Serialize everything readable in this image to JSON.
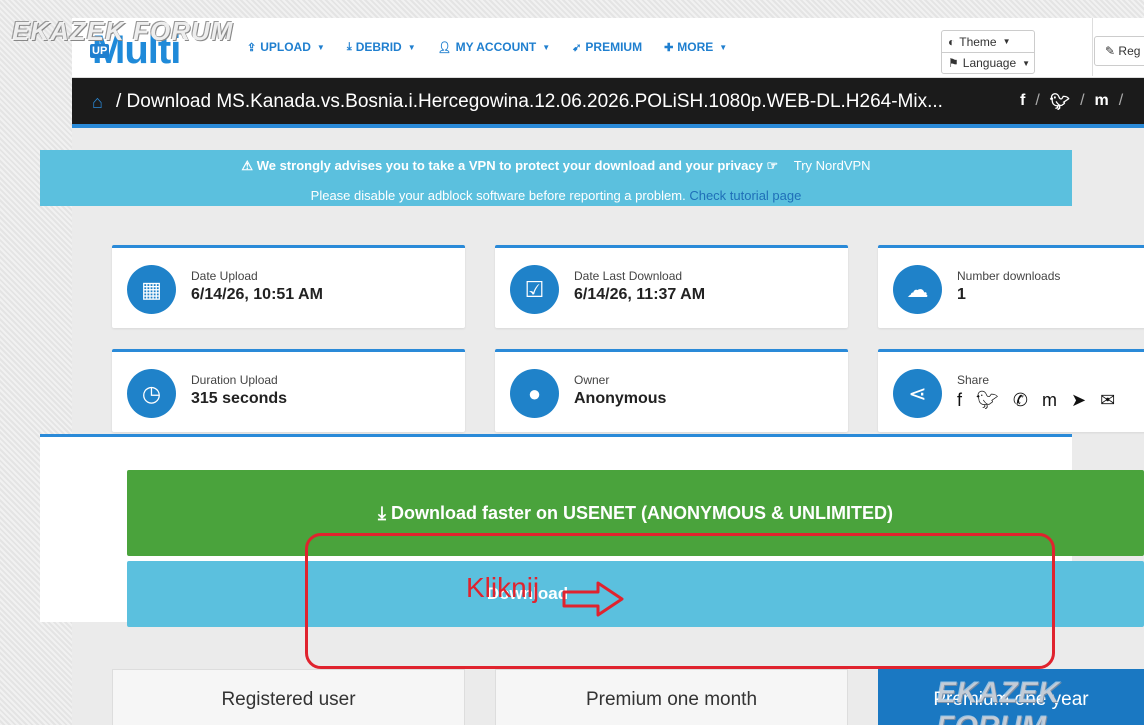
{
  "watermarks": {
    "top_left": "EKAZEK FORUM",
    "bottom_right": "EKAZEK FORUM"
  },
  "logo": {
    "badge": "UP",
    "text": "Multi"
  },
  "nav": [
    {
      "icon": "upload-icon",
      "label": "UPLOAD",
      "dropdown": true
    },
    {
      "icon": "download-icon",
      "label": "DEBRID",
      "dropdown": true
    },
    {
      "icon": "user-icon",
      "label": "MY ACCOUNT",
      "dropdown": true
    },
    {
      "icon": "rocket-icon",
      "label": "PREMIUM",
      "dropdown": false
    },
    {
      "icon": "plus-icon",
      "label": "MORE",
      "dropdown": true
    }
  ],
  "header_controls": {
    "theme": "Theme",
    "language": "Language",
    "register": "Reg"
  },
  "titlebar": {
    "title": "/ Download MS.Kanada.vs.Bosnia.i.Hercegowina.12.06.2026.POLiSH.1080p.WEB-DL.H264-Mix...",
    "social": [
      "f",
      "/",
      "twitter",
      "/",
      "m",
      "/"
    ]
  },
  "vpn_notice": {
    "line1": "We strongly advises you to take a VPN to protect your download and your privacy",
    "try_link": "Try NordVPN",
    "line2": "Please disable your adblock software before reporting a problem.",
    "tutorial_link": "Check tutorial page"
  },
  "stats": {
    "date_upload": {
      "label": "Date Upload",
      "value": "6/14/26, 10:51 AM"
    },
    "date_last_download": {
      "label": "Date Last Download",
      "value": "6/14/26, 11:37 AM"
    },
    "number_downloads": {
      "label": "Number downloads",
      "value": "1"
    },
    "duration_upload": {
      "label": "Duration Upload",
      "value": "315 seconds"
    },
    "owner": {
      "label": "Owner",
      "value": "Anonymous"
    },
    "share": {
      "label": "Share"
    }
  },
  "buttons": {
    "usenet": "Download faster on USENET (ANONYMOUS & UNLIMITED)",
    "download": "Download"
  },
  "annotation": {
    "text": "Kliknij",
    "color": "#e0232e"
  },
  "plans": [
    "Registered user",
    "Premium one month",
    "Premium one year"
  ],
  "colors": {
    "accent": "#2a8ad8",
    "green": "#4aa33c",
    "info": "#5bc0de",
    "dark": "#1b1b1b"
  }
}
